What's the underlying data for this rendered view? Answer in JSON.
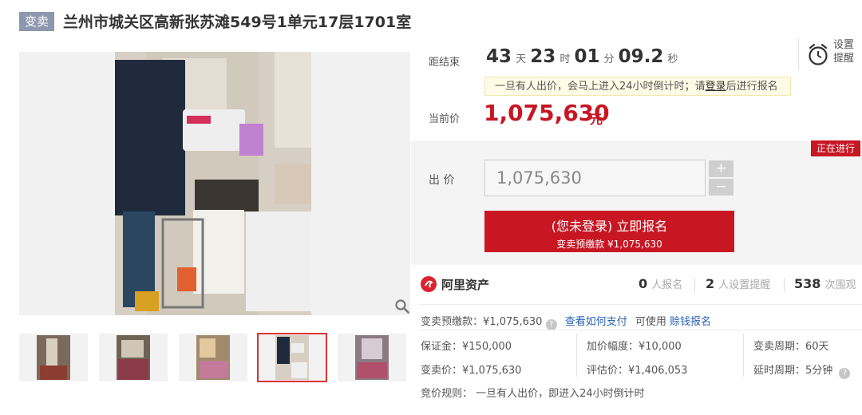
{
  "header": {
    "tag": "变卖",
    "title": "兰州市城关区高新张苏滩549号1单元17层1701室"
  },
  "countdown": {
    "label": "距结束",
    "days": "43",
    "days_unit": "天",
    "hours": "23",
    "hours_unit": "时",
    "minutes": "01",
    "minutes_unit": "分",
    "seconds": "09.2",
    "seconds_unit": "秒"
  },
  "remind": {
    "line1": "设置",
    "line2": "提醒"
  },
  "notice": {
    "before": "一旦有人出价，会马上进入24小时倒计时；请",
    "link": "登录",
    "after": "后进行报名"
  },
  "current_price": {
    "label": "当前价",
    "value": "1,075,630",
    "unit": "元"
  },
  "status_badge": "正在进行",
  "bid": {
    "label": "出 价",
    "input_value": "1,075,630",
    "plus": "+",
    "minus": "−",
    "signup_line1": "(您未登录) 立即报名",
    "signup_line2": "变卖预缴款 ¥1,075,630"
  },
  "stats": {
    "brand": "阿里资产",
    "signups": {
      "num": "0",
      "label": "人报名"
    },
    "reminders": {
      "num": "2",
      "label": "人设置提醒"
    },
    "views": {
      "num": "538",
      "label": "次围观"
    }
  },
  "details": {
    "prepay_label": "变卖预缴款：",
    "prepay_value": "¥1,075,630",
    "how_to_pay": "查看如何支付",
    "can_use": "可使用",
    "credit_signup": "赊钱报名",
    "deposit": "保证金：¥150,000",
    "increment": "加价幅度：¥10,000",
    "period": "变卖周期：60天",
    "sale_price": "变卖价：¥1,075,630",
    "appraisal": "评估价：¥1,406,053",
    "extension": "延时周期：5分钟",
    "rule": "竞价规则：  一旦有人出价，即进入24小时倒计时"
  },
  "icons": {
    "zoom": "magnifier-icon",
    "alarm": "alarm-clock-icon",
    "help": "question-icon"
  }
}
